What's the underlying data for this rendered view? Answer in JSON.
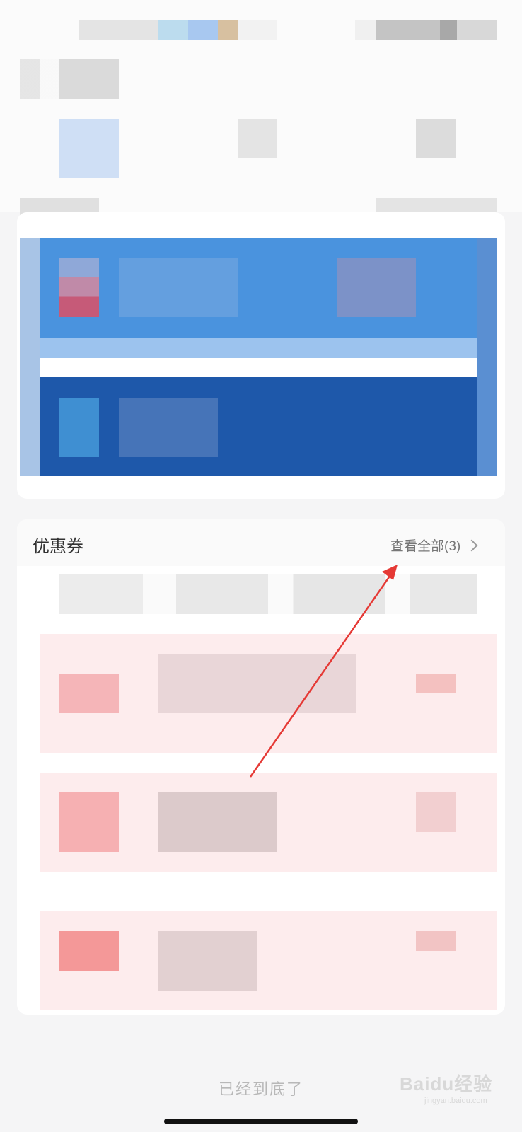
{
  "coupons": {
    "title": "优惠券",
    "view_all": "查看全部(3)"
  },
  "footer": {
    "end_text": "已经到底了"
  },
  "watermark": {
    "brand": "Baidu经验",
    "domain": "jingyan.baidu.com"
  },
  "annotation": {
    "arrow_color": "#e53935"
  },
  "colors": {
    "card_blue": "#4a93de",
    "card_dark_blue": "#1e58aa",
    "coupon_pink": "#fdeced"
  }
}
